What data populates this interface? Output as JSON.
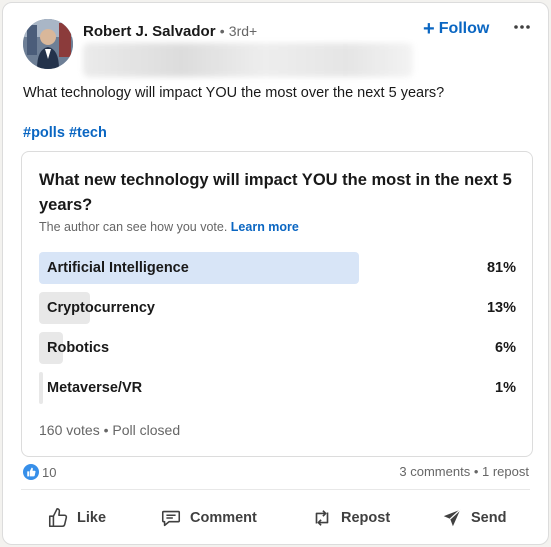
{
  "author": {
    "name": "Robert J. Salvador",
    "separator": "•",
    "degree": "3rd+",
    "follow_label": "Follow",
    "follow_icon": "plus-icon",
    "more_icon": "ellipsis-icon"
  },
  "post": {
    "text": "What technology will impact YOU the most over the next 5 years?",
    "tags": [
      "#polls",
      "#tech"
    ]
  },
  "poll": {
    "question": "What new technology will impact YOU the most in the next 5 years?",
    "note": "The author can see how you vote.",
    "learn_more": "Learn more",
    "options": [
      {
        "label": "Artificial Intelligence",
        "percent": "81%",
        "fraction": 0.81,
        "selected_winner": true
      },
      {
        "label": "Cryptocurrency",
        "percent": "13%",
        "fraction": 0.13
      },
      {
        "label": "Robotics",
        "percent": "6%",
        "fraction": 0.06
      },
      {
        "label": "Metaverse/VR",
        "percent": "1%",
        "fraction": 0.01
      }
    ],
    "votes": "160 votes",
    "dot": "•",
    "status": "Poll closed"
  },
  "social": {
    "reaction_count": "10",
    "reaction_icon": "thumbs-up-icon",
    "comments": "3 comments",
    "dot": "•",
    "reposts": "1 repost"
  },
  "actions": {
    "like": "Like",
    "comment": "Comment",
    "repost": "Repost",
    "send": "Send"
  },
  "colors": {
    "accent": "#0a66c2",
    "winner_bar": "#d8e5f7",
    "option_bar": "#e8e8e8",
    "like_badge": "#378fe9"
  }
}
